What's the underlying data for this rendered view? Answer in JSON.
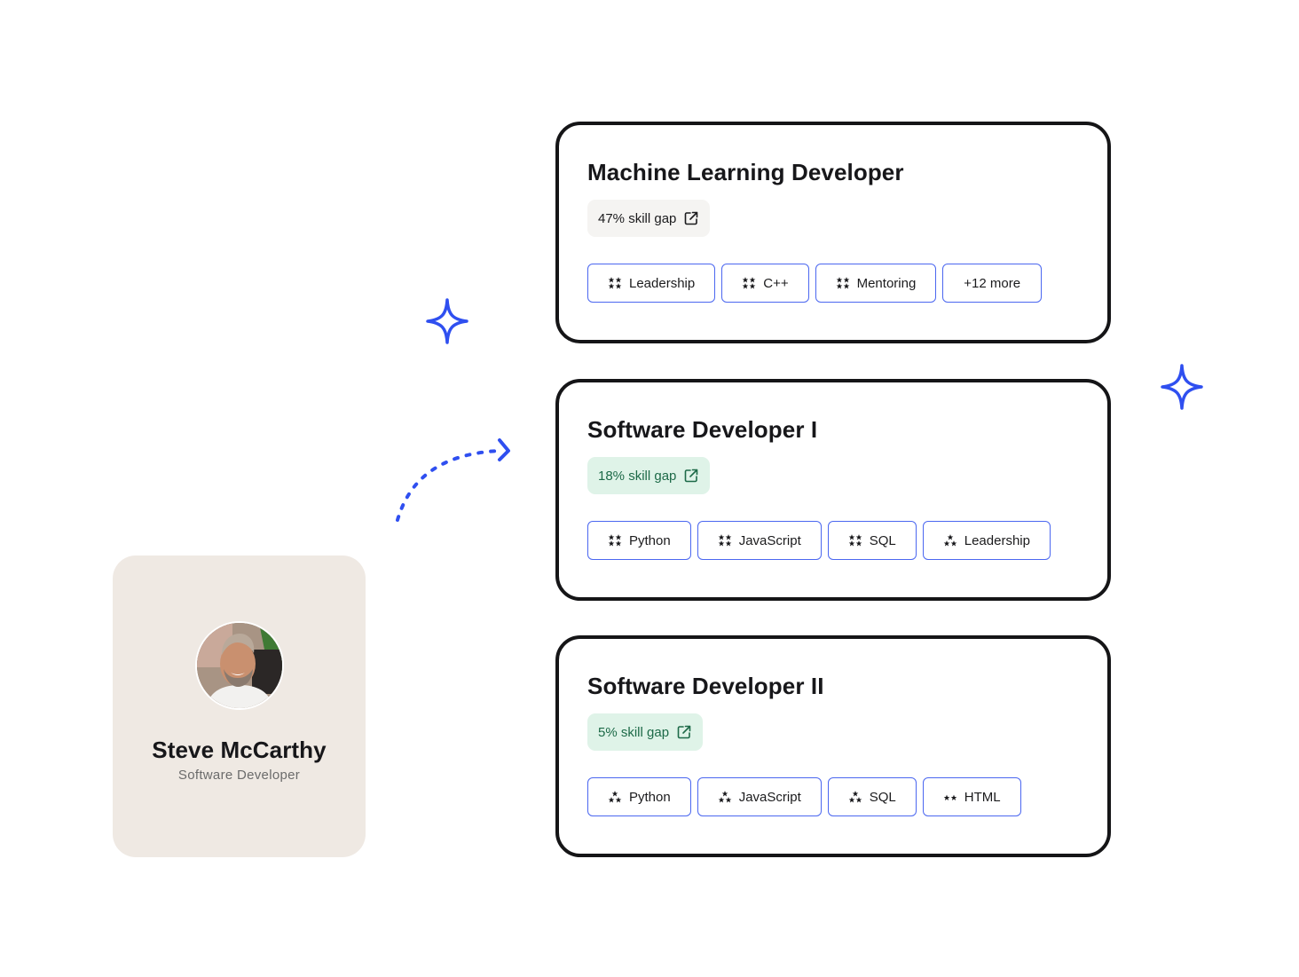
{
  "profile": {
    "name": "Steve McCarthy",
    "role": "Software Developer",
    "avatar_icon": "person-photo"
  },
  "decorations": {
    "sparkle_icon": "sparkle-icon",
    "arrow_icon": "dotted-curved-arrow-icon",
    "accent_color": "#2f4ff0"
  },
  "colors": {
    "pill_border": "#4b67f0",
    "good_gap_bg": "#dff3e8",
    "good_gap_text": "#1d6a48",
    "neutral_gap_bg": "#f5f4f2",
    "profile_bg": "#efe9e3"
  },
  "jobs": [
    {
      "title": "Machine Learning Developer",
      "skill_gap": "47% skill gap",
      "skill_gap_percent": 47,
      "gap_style": "neutral",
      "skills": [
        {
          "label": "Leadership",
          "level": 4
        },
        {
          "label": "C++",
          "level": 4
        },
        {
          "label": "Mentoring",
          "level": 4
        },
        {
          "label": "+12 more",
          "level": 0
        }
      ]
    },
    {
      "title": "Software Developer I",
      "skill_gap": "18% skill gap",
      "skill_gap_percent": 18,
      "gap_style": "good",
      "skills": [
        {
          "label": "Python",
          "level": 4
        },
        {
          "label": "JavaScript",
          "level": 4
        },
        {
          "label": "SQL",
          "level": 4
        },
        {
          "label": "Leadership",
          "level": 3
        }
      ]
    },
    {
      "title": "Software Developer II",
      "skill_gap": "5% skill gap",
      "skill_gap_percent": 5,
      "gap_style": "good",
      "skills": [
        {
          "label": "Python",
          "level": 3
        },
        {
          "label": "JavaScript",
          "level": 3
        },
        {
          "label": "SQL",
          "level": 3
        },
        {
          "label": "HTML",
          "level": 2
        }
      ]
    }
  ]
}
